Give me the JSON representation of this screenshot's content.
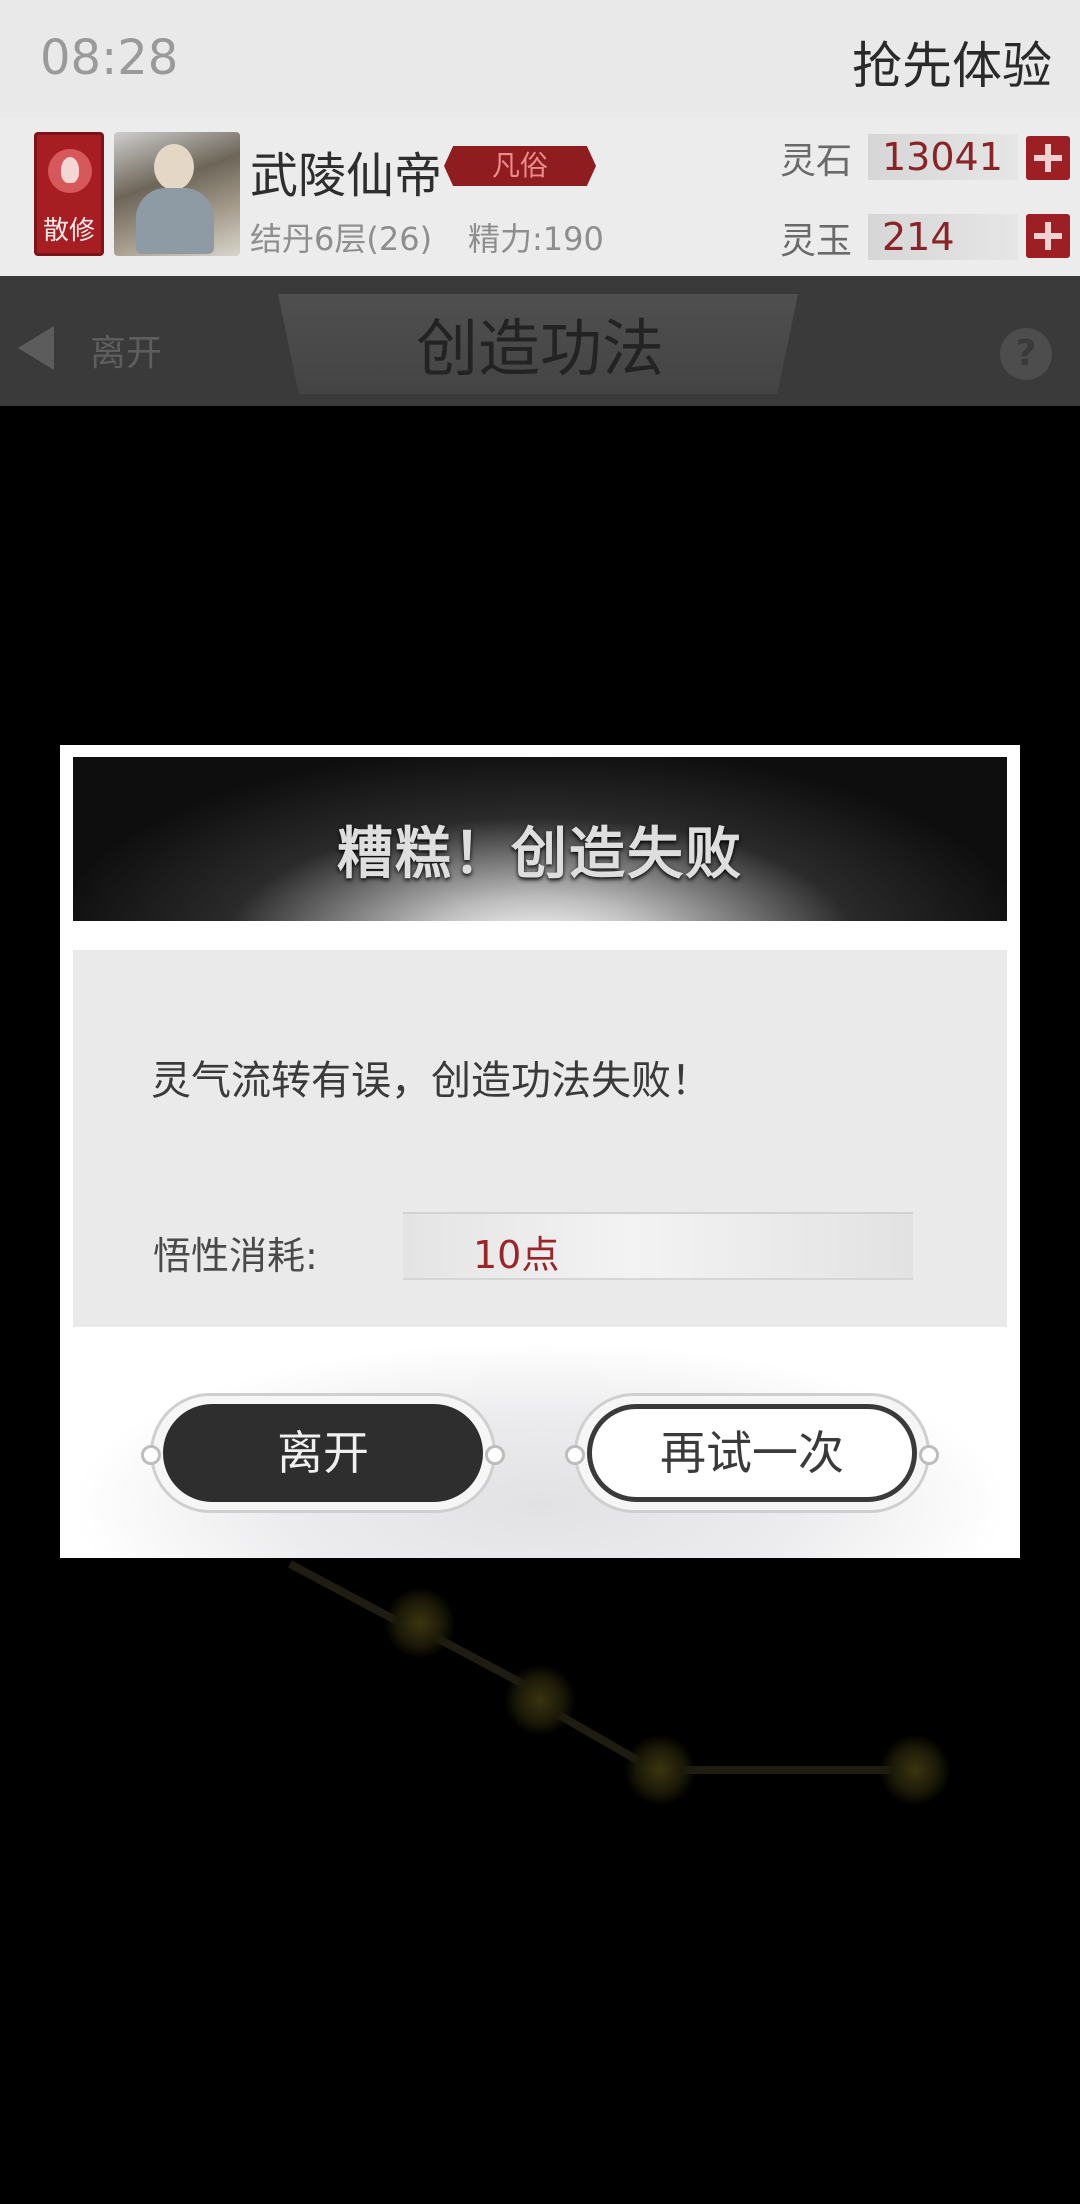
{
  "status_bar": {
    "time": "08:28",
    "early_access": "抢先体验"
  },
  "player": {
    "sect_badge": "散修",
    "name": "武陵仙帝",
    "rank_tag": "凡俗",
    "realm": "结丹6层(26)",
    "energy": "精力:190"
  },
  "resources": [
    {
      "label": "灵石",
      "value": "13041"
    },
    {
      "label": "灵玉",
      "value": "214"
    }
  ],
  "title_bar": {
    "back_label": "离开",
    "title": "创造功法",
    "help_icon": "?"
  },
  "dialog": {
    "title": "糟糕！创造失败",
    "message": "灵气流转有误，创造功法失败！",
    "cost_label": "悟性消耗:",
    "cost_value": "10点",
    "buttons": {
      "leave": "离开",
      "retry": "再试一次"
    }
  },
  "colors": {
    "accent_red": "#a61e22",
    "value_red": "#9a2528",
    "overlay": "#000000"
  }
}
